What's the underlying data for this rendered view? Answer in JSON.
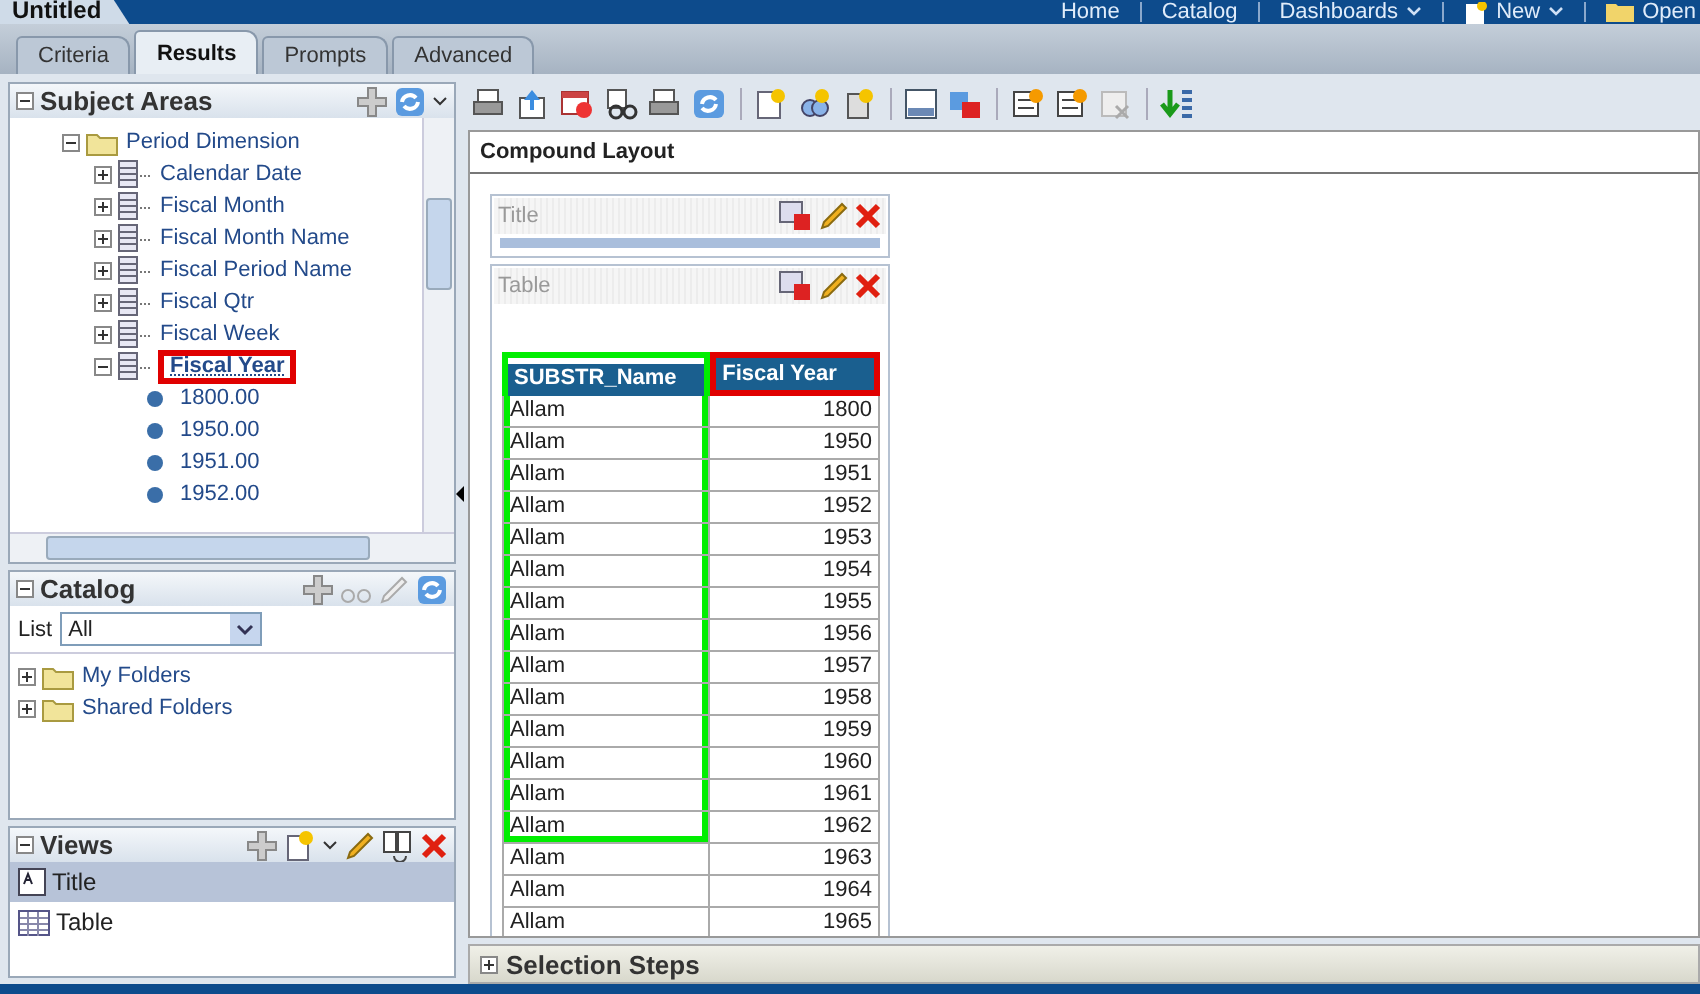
{
  "window": {
    "title": "Untitled"
  },
  "nav": [
    {
      "label": "Home",
      "menu": false
    },
    {
      "label": "Catalog",
      "menu": false
    },
    {
      "label": "Dashboards",
      "menu": true
    },
    {
      "label": "New",
      "menu": true
    },
    {
      "label": "Open",
      "menu": false
    }
  ],
  "tabs": [
    {
      "label": "Criteria",
      "selected": false
    },
    {
      "label": "Results",
      "selected": true
    },
    {
      "label": "Prompts",
      "selected": false
    },
    {
      "label": "Advanced",
      "selected": false
    }
  ],
  "subject_areas": {
    "title": "Subject Areas",
    "tree": [
      {
        "label": "Period Dimension",
        "kind": "folder",
        "expanded": true,
        "selected": false,
        "highlighted": false,
        "children": [
          {
            "label": "Calendar Date",
            "kind": "column",
            "expanded": false,
            "selected": false,
            "highlighted": false
          },
          {
            "label": "Fiscal Month",
            "kind": "column",
            "expanded": false,
            "selected": false,
            "highlighted": false
          },
          {
            "label": "Fiscal Month Name",
            "kind": "column",
            "expanded": false,
            "selected": false,
            "highlighted": false
          },
          {
            "label": "Fiscal Period Name",
            "kind": "column",
            "expanded": false,
            "selected": false,
            "highlighted": false
          },
          {
            "label": "Fiscal Qtr",
            "kind": "column",
            "expanded": false,
            "selected": false,
            "highlighted": false
          },
          {
            "label": "Fiscal Week",
            "kind": "column",
            "expanded": false,
            "selected": false,
            "highlighted": false
          },
          {
            "label": "Fiscal Year",
            "kind": "column",
            "expanded": true,
            "selected": true,
            "highlighted": true,
            "children": [
              {
                "label": "1800.00",
                "kind": "value"
              },
              {
                "label": "1950.00",
                "kind": "value"
              },
              {
                "label": "1951.00",
                "kind": "value"
              },
              {
                "label": "1952.00",
                "kind": "value"
              }
            ]
          }
        ]
      }
    ]
  },
  "catalog": {
    "title": "Catalog",
    "list_label": "List",
    "list_value": "All",
    "tree": [
      {
        "label": "My Folders",
        "kind": "folder",
        "expanded": false
      },
      {
        "label": "Shared Folders",
        "kind": "folder",
        "expanded": false
      }
    ]
  },
  "views": {
    "title": "Views",
    "items": [
      {
        "label": "Title",
        "kind": "title",
        "selected": true
      },
      {
        "label": "Table",
        "kind": "table",
        "selected": false
      }
    ]
  },
  "compound_layout": {
    "title": "Compound Layout",
    "views": [
      {
        "label": "Title",
        "kind": "title"
      },
      {
        "label": "Table",
        "kind": "table"
      }
    ],
    "table": {
      "columns": [
        {
          "label": "SUBSTR_Name",
          "color": "#00ee00"
        },
        {
          "label": "Fiscal Year",
          "color": "#e00000"
        }
      ],
      "rows": [
        {
          "cells": [
            "Allam",
            "1800"
          ],
          "outlined": true
        },
        {
          "cells": [
            "Allam",
            "1950"
          ],
          "outlined": true
        },
        {
          "cells": [
            "Allam",
            "1951"
          ],
          "outlined": true
        },
        {
          "cells": [
            "Allam",
            "1952"
          ],
          "outlined": true
        },
        {
          "cells": [
            "Allam",
            "1953"
          ],
          "outlined": true
        },
        {
          "cells": [
            "Allam",
            "1954"
          ],
          "outlined": true
        },
        {
          "cells": [
            "Allam",
            "1955"
          ],
          "outlined": true
        },
        {
          "cells": [
            "Allam",
            "1956"
          ],
          "outlined": true
        },
        {
          "cells": [
            "Allam",
            "1957"
          ],
          "outlined": true
        },
        {
          "cells": [
            "Allam",
            "1958"
          ],
          "outlined": true
        },
        {
          "cells": [
            "Allam",
            "1959"
          ],
          "outlined": true
        },
        {
          "cells": [
            "Allam",
            "1960"
          ],
          "outlined": true
        },
        {
          "cells": [
            "Allam",
            "1961"
          ],
          "outlined": true
        },
        {
          "cells": [
            "Allam",
            "1962"
          ],
          "outlined": true
        },
        {
          "cells": [
            "Allam",
            "1963"
          ],
          "outlined": false
        },
        {
          "cells": [
            "Allam",
            "1964"
          ],
          "outlined": false
        },
        {
          "cells": [
            "Allam",
            "1965"
          ],
          "outlined": false
        }
      ]
    }
  },
  "selection_steps": {
    "title": "Selection Steps",
    "expanded": false
  }
}
